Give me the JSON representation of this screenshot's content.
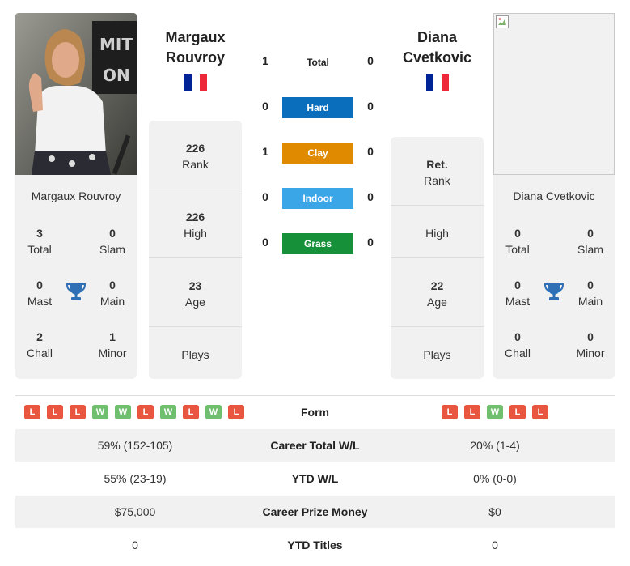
{
  "player1": {
    "name": "Margaux Rouvroy",
    "name_line1": "Margaux",
    "name_line2": "Rouvroy",
    "flag_colors": [
      "#002395",
      "#ffffff",
      "#ed2939"
    ],
    "stats": {
      "total": "3",
      "total_label": "Total",
      "slam": "0",
      "slam_label": "Slam",
      "mast": "0",
      "mast_label": "Mast",
      "main": "0",
      "main_label": "Main",
      "chall": "2",
      "chall_label": "Chall",
      "minor": "1",
      "minor_label": "Minor"
    },
    "rank": "226",
    "rank_label": "Rank",
    "high": "226",
    "high_label": "High",
    "age": "23",
    "age_label": "Age",
    "plays_label": "Plays",
    "form": [
      "L",
      "L",
      "L",
      "W",
      "W",
      "L",
      "W",
      "L",
      "W",
      "L"
    ]
  },
  "player2": {
    "name": "Diana Cvetkovic",
    "name_line1": "Diana",
    "name_line2": "Cvetkovic",
    "flag_colors": [
      "#002395",
      "#ffffff",
      "#ed2939"
    ],
    "stats": {
      "total": "0",
      "total_label": "Total",
      "slam": "0",
      "slam_label": "Slam",
      "mast": "0",
      "mast_label": "Mast",
      "main": "0",
      "main_label": "Main",
      "chall": "0",
      "chall_label": "Chall",
      "minor": "0",
      "minor_label": "Minor"
    },
    "rank": "Ret.",
    "rank_label": "Rank",
    "high_label": "High",
    "age": "22",
    "age_label": "Age",
    "plays_label": "Plays",
    "form": [
      "L",
      "L",
      "W",
      "L",
      "L"
    ]
  },
  "h2h": {
    "total": {
      "label": "Total",
      "p1": "1",
      "p2": "0"
    },
    "surfaces": [
      {
        "label": "Hard",
        "p1": "0",
        "p2": "0",
        "color": "#0a6ebd"
      },
      {
        "label": "Clay",
        "p1": "1",
        "p2": "0",
        "color": "#e08a00"
      },
      {
        "label": "Indoor",
        "p1": "0",
        "p2": "0",
        "color": "#3aa6e8"
      },
      {
        "label": "Grass",
        "p1": "0",
        "p2": "0",
        "color": "#16913a"
      }
    ]
  },
  "form_colors": {
    "L": "#e8563f",
    "W": "#6fbf6f"
  },
  "comparison": {
    "form_label": "Form",
    "rows": [
      {
        "label": "Career Total W/L",
        "p1": "59% (152-105)",
        "p2": "20% (1-4)"
      },
      {
        "label": "YTD W/L",
        "p1": "55% (23-19)",
        "p2": "0% (0-0)"
      },
      {
        "label": "Career Prize Money",
        "p1": "$75,000",
        "p2": "$0"
      },
      {
        "label": "YTD Titles",
        "p1": "0",
        "p2": "0"
      }
    ]
  },
  "icons": {
    "trophy": "trophy-icon",
    "broken_image": "broken-image-icon"
  }
}
